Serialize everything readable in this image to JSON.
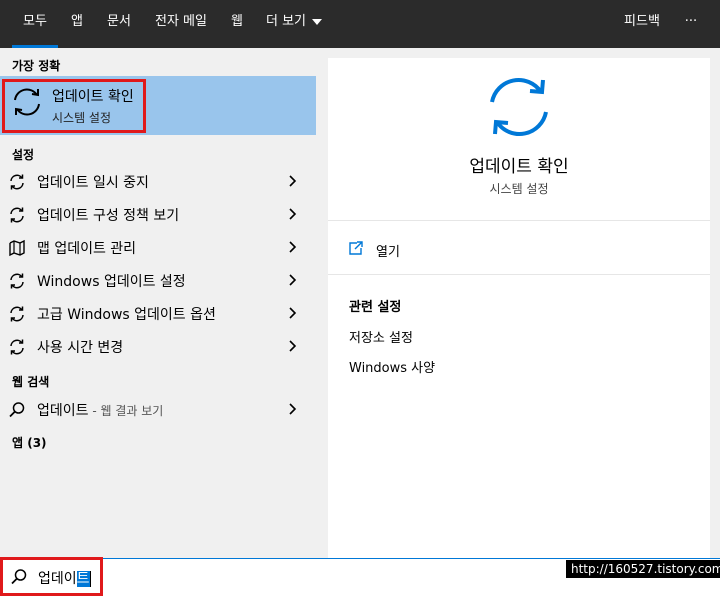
{
  "tabs": [
    {
      "label": "모두"
    },
    {
      "label": "앱"
    },
    {
      "label": "문서"
    },
    {
      "label": "전자 메일"
    },
    {
      "label": "웹"
    },
    {
      "label": "더 보기"
    }
  ],
  "topbar": {
    "feedback": "피드백",
    "more": "···"
  },
  "left": {
    "best_match_heading": "가장 정확",
    "best_match": {
      "title": "업데이트 확인",
      "subtitle": "시스템 설정"
    },
    "settings_heading": "설정",
    "settings": [
      {
        "label": "업데이트 일시 중지"
      },
      {
        "label": "업데이트 구성 정책 보기"
      },
      {
        "label": "맵 업데이트 관리"
      },
      {
        "label": "Windows 업데이트 설정"
      },
      {
        "label": "고급 Windows 업데이트 옵션"
      },
      {
        "label": "사용 시간 변경"
      }
    ],
    "web_heading": "웹 검색",
    "web_item": {
      "label": "업데이트",
      "suffix": " - 웹 결과 보기"
    },
    "apps_heading": "앱 (3)"
  },
  "right": {
    "title": "업데이트 확인",
    "subtitle": "시스템 설정",
    "open": "열기",
    "related_title": "관련 설정",
    "related": [
      {
        "label": "저장소 설정"
      },
      {
        "label": "Windows 사양"
      }
    ]
  },
  "search": {
    "typed": "업데이",
    "selected": "트"
  },
  "watermark": "http://160527.tistory.com",
  "colors": {
    "accent": "#0078d7",
    "highlight": "#99c5ec",
    "annotation": "#e0191b",
    "topbar": "#2b2b2b"
  }
}
